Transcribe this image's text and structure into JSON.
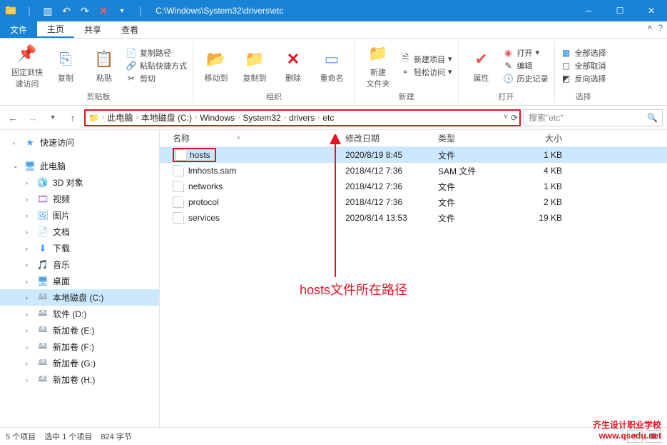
{
  "title": "C:\\Windows\\System32\\drivers\\etc",
  "tabs": {
    "file": "文件",
    "home": "主页",
    "share": "共享",
    "view": "查看"
  },
  "ribbon": {
    "pin": "固定到快\n速访问",
    "copy": "复制",
    "paste": "粘贴",
    "copy_path": "复制路径",
    "paste_shortcut": "粘贴快捷方式",
    "cut": "剪切",
    "group_clipboard": "剪贴板",
    "move_to": "移动到",
    "copy_to": "复制到",
    "delete": "删除",
    "rename": "重命名",
    "group_organize": "组织",
    "new_folder": "新建\n文件夹",
    "new_item": "新建项目",
    "easy_access": "轻松访问",
    "group_new": "新建",
    "properties": "属性",
    "open": "打开",
    "edit": "编辑",
    "history": "历史记录",
    "group_open": "打开",
    "select_all": "全部选择",
    "select_none": "全部取消",
    "invert_selection": "反向选择",
    "group_select": "选择"
  },
  "breadcrumb": [
    "此电脑",
    "本地磁盘 (C:)",
    "Windows",
    "System32",
    "drivers",
    "etc"
  ],
  "search_placeholder": "搜索\"etc\"",
  "nav_pane": {
    "quick_access": "快速访问",
    "this_pc": "此电脑",
    "objects_3d": "3D 对象",
    "videos": "视频",
    "pictures": "图片",
    "documents": "文档",
    "downloads": "下载",
    "music": "音乐",
    "desktop": "桌面",
    "local_c": "本地磁盘 (C:)",
    "soft_d": "软件 (D:)",
    "vol_e": "新加卷 (E:)",
    "vol_f": "新加卷 (F:)",
    "vol_g": "新加卷 (G:)",
    "vol_h": "新加卷 (H:)"
  },
  "columns": {
    "name": "名称",
    "date": "修改日期",
    "type": "类型",
    "size": "大小"
  },
  "files": [
    {
      "name": "hosts",
      "date": "2020/8/19 8:45",
      "type": "文件",
      "size": "1 KB",
      "selected": true
    },
    {
      "name": "lmhosts.sam",
      "date": "2018/4/12 7:36",
      "type": "SAM 文件",
      "size": "4 KB"
    },
    {
      "name": "networks",
      "date": "2018/4/12 7:36",
      "type": "文件",
      "size": "1 KB"
    },
    {
      "name": "protocol",
      "date": "2018/4/12 7:36",
      "type": "文件",
      "size": "2 KB"
    },
    {
      "name": "services",
      "date": "2020/8/14 13:53",
      "type": "文件",
      "size": "19 KB"
    }
  ],
  "status": {
    "count": "5 个项目",
    "selected": "选中 1 个项目",
    "bytes": "824 字节"
  },
  "annotation": "hosts文件所在路径",
  "watermark": {
    "line1": "齐生设计职业学校",
    "line2": "www.qsedu.net"
  }
}
